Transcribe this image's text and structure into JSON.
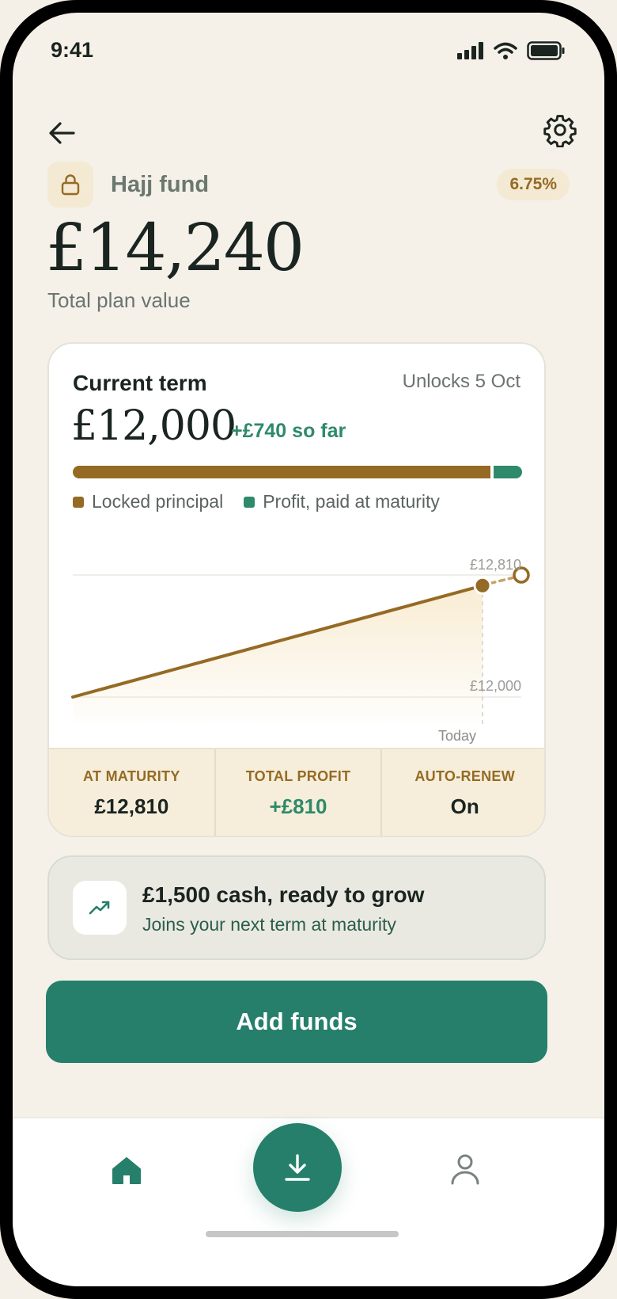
{
  "status_bar": {
    "time": "9:41"
  },
  "header": {
    "fund_name": "Hajj fund",
    "rate": "6.75%",
    "total_value": "£14,240",
    "total_value_label": "Total plan value"
  },
  "term_card": {
    "title": "Current term",
    "unlock_text": "Unlocks 5 Oct",
    "amount": "£12,000",
    "profit_text": "+£740 so far",
    "progress": {
      "principal": 12000,
      "profit": 810
    },
    "legend": [
      {
        "label": "Locked principal",
        "color": "#956a24"
      },
      {
        "label": "Profit, paid at maturity",
        "color": "#2e8a6a"
      }
    ]
  },
  "chart_data": {
    "type": "line",
    "series": [
      {
        "x": [
          "start",
          "Today"
        ],
        "values": [
          12000,
          12740
        ],
        "style": "solid"
      },
      {
        "x": [
          "Today",
          "maturity"
        ],
        "values": [
          12740,
          12810
        ],
        "style": "dashed"
      }
    ],
    "annotations": [
      {
        "label": "£12,810",
        "value": 12810
      },
      {
        "label": "£12,000",
        "value": 12000
      }
    ],
    "today_label": "Today",
    "ylim": [
      12000,
      12810
    ],
    "grid": true,
    "colors": {
      "line": "#956a24",
      "fill": "#f6e6c4"
    }
  },
  "stats": [
    {
      "label": "AT MATURITY",
      "value": "£12,810",
      "tone": "dark"
    },
    {
      "label": "TOTAL PROFIT",
      "value": "+£810",
      "tone": "green"
    },
    {
      "label": "AUTO-RENEW",
      "value": "On",
      "tone": "dark"
    }
  ],
  "cash_card": {
    "icon": "trending-up-icon",
    "title": "£1,500 cash, ready to grow",
    "subtitle": "Joins your next term at maturity"
  },
  "add_funds_label": "Add funds",
  "nav": {
    "items": [
      {
        "icon": "home-icon",
        "active": true
      },
      {
        "icon": "download-icon",
        "primary": true
      },
      {
        "icon": "profile-icon",
        "active": false
      }
    ]
  },
  "colors": {
    "accent_green": "#257f6b",
    "accent_gold": "#956a24",
    "background": "#f5f1e9"
  }
}
